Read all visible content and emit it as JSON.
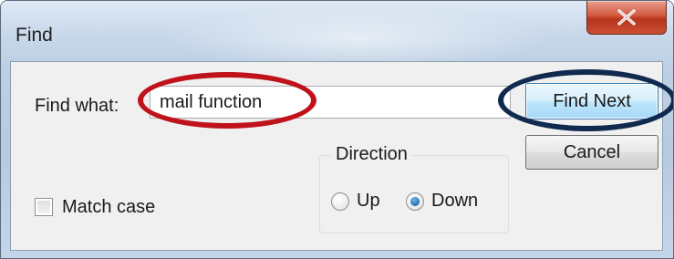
{
  "window": {
    "title": "Find"
  },
  "titlebar": {
    "close_icon": "close-x-icon"
  },
  "find": {
    "label": "Find what:",
    "value": "mail function"
  },
  "buttons": {
    "find_next": "Find Next",
    "cancel": "Cancel"
  },
  "direction": {
    "legend": "Direction",
    "options": [
      {
        "label": "Up",
        "selected": false
      },
      {
        "label": "Down",
        "selected": true
      }
    ]
  },
  "options": {
    "match_case_label": "Match case",
    "match_case_checked": false
  },
  "colors": {
    "highlight_red": "#c0121a",
    "highlight_navy": "#102a4f",
    "close_button": "#c84f33"
  }
}
